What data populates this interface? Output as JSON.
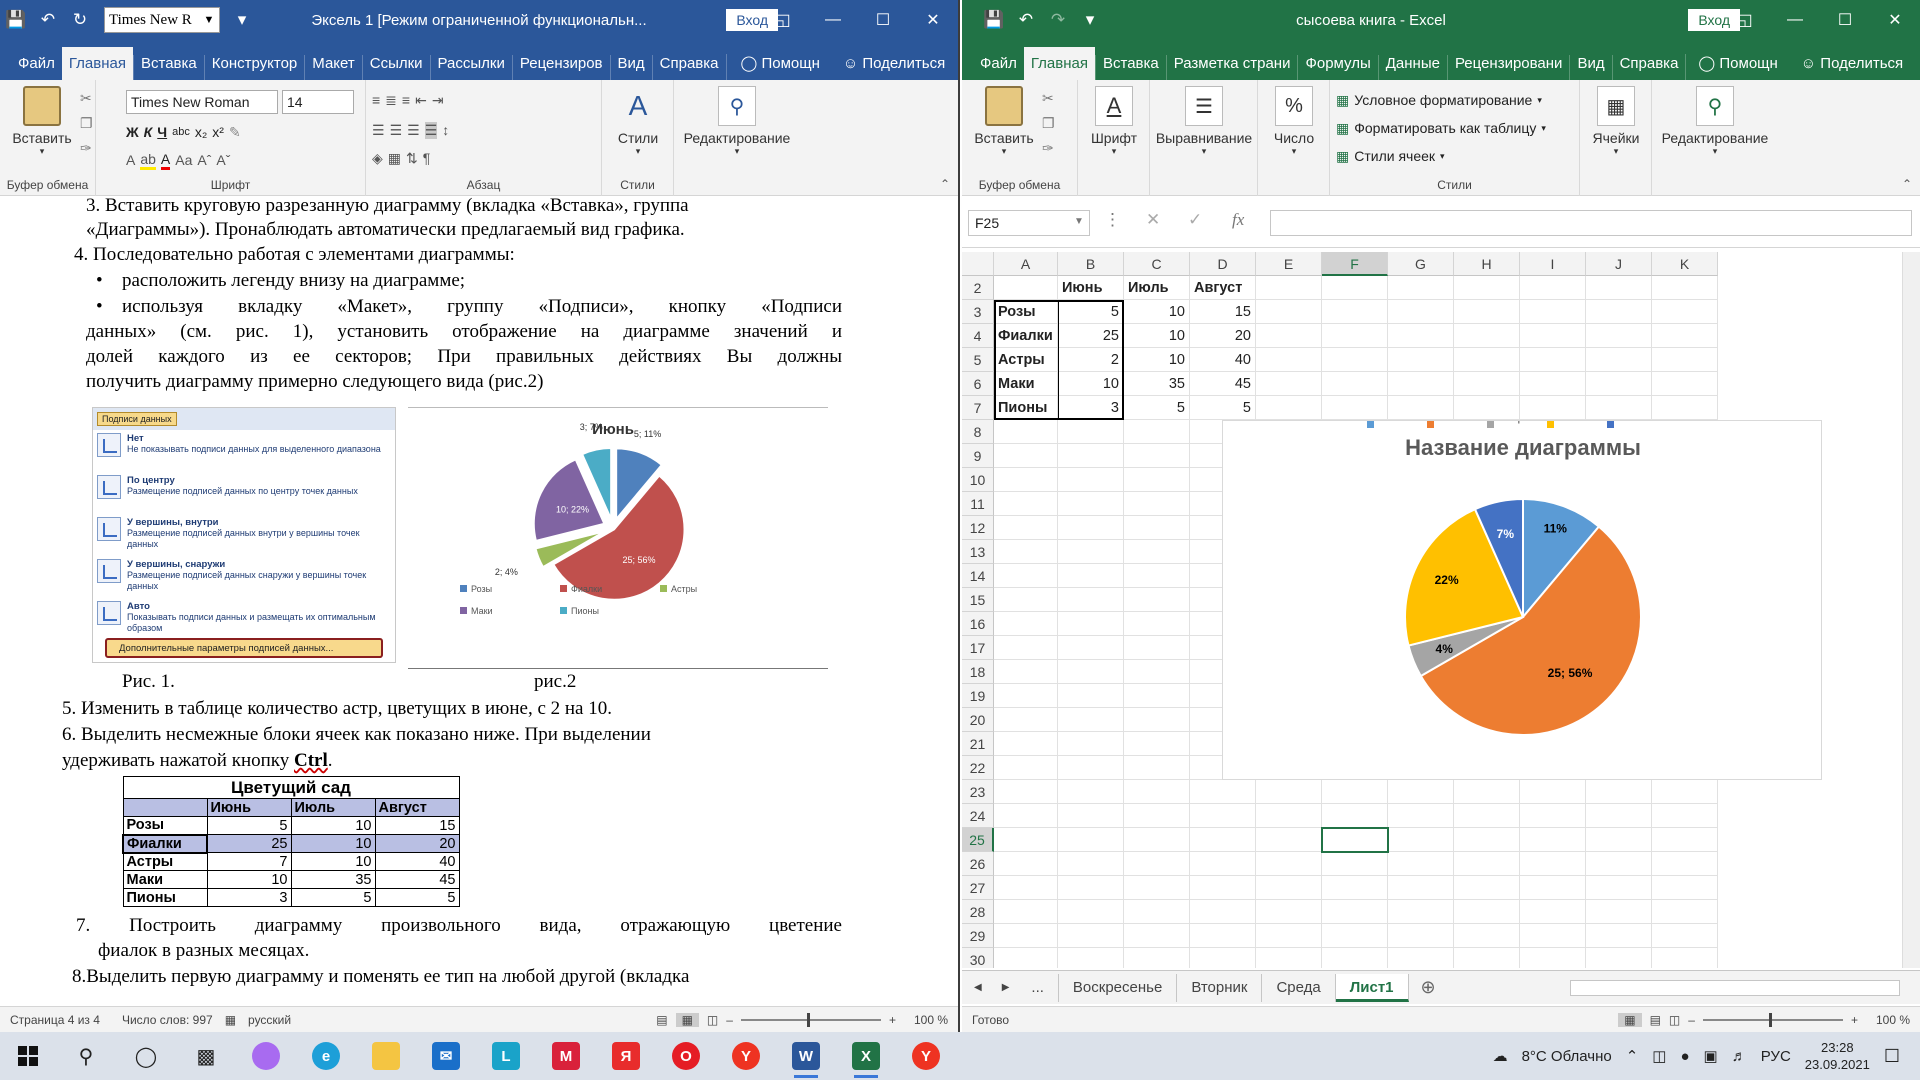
{
  "word": {
    "title": "Эксель 1 [Режим ограниченной функциональн...",
    "font_name_small": "Times New R",
    "login": "Вход",
    "tabs": [
      "Файл",
      "Главная",
      "Вставка",
      "Конструктор",
      "Макет",
      "Ссылки",
      "Рассылки",
      "Рецензиров",
      "Вид",
      "Справка",
      "Помощн",
      "Поделиться"
    ],
    "ribbon": {
      "paste": "Вставить",
      "font_name": "Times New Roman",
      "font_size": "14",
      "styles": "Стили",
      "editing": "Редактирование",
      "groups": [
        "Буфер обмена",
        "Шрифт",
        "Абзац",
        "Стили"
      ]
    },
    "doc": {
      "l1": "3.   Вставить круговую разрезанную диаграмму (вкладка «Вставка», группа",
      "l2": "«Диаграммы»). Пронаблюдать автоматически предлагаемый вид графика.",
      "l3": "4.      Последовательно работая с элементами диаграммы:",
      "l4": "расположить легенду внизу на диаграмме;",
      "l5": "используя вкладку «Макет», группу «Подписи», кнопку «Подписи",
      "l6": "данных» (см. рис. 1), установить отображение на диаграмме значений и",
      "l7": "долей каждого из ее секторов; При правильных действиях Вы должны",
      "l8": "получить диаграмму примерно следующего вида (рис.2)",
      "cap1": "Рис. 1.",
      "cap2": "рис.2",
      "l9": "5.      Изменить в таблице количество астр, цветущих в июне, с 2 на 10.",
      "l10": "6.      Выделить несмежные блоки ячеек как показано ниже. При выделении",
      "l11a": "удерживать нажатой кнопку ",
      "l11b": "Ctrl",
      "l12": "7. Построить    диаграмму    произвольного    вида,    отражающую    цветение",
      "l13": "фиалок в разных месяцах.",
      "l14": "8.Выделить первую диаграмму и поменять ее тип на любой другой (вкладка"
    },
    "fig1": {
      "button": "Подписи данных",
      "items": [
        {
          "title": "Нет",
          "desc": "Не показывать подписи данных для выделенного диапазона"
        },
        {
          "title": "По центру",
          "desc": "Размещение подписей данных по центру точек данных"
        },
        {
          "title": "У вершины, внутри",
          "desc": "Размещение подписей данных внутри у вершины точек данных"
        },
        {
          "title": "У вершины, снаружи",
          "desc": "Размещение подписей данных снаружи у вершины точек данных"
        },
        {
          "title": "Авто",
          "desc": "Показывать подписи данных и размещать их оптимальным образом"
        }
      ],
      "more": "Дополнительные параметры подписей данных..."
    },
    "table": {
      "title": "Цветущий сад",
      "headers": [
        "",
        "Июнь",
        "Июль",
        "Август"
      ],
      "rows": [
        [
          "Розы",
          "5",
          "10",
          "15"
        ],
        [
          "Фиалки",
          "25",
          "10",
          "20"
        ],
        [
          "Астры",
          "7",
          "10",
          "40"
        ],
        [
          "Маки",
          "10",
          "35",
          "45"
        ],
        [
          "Пионы",
          "3",
          "5",
          "5"
        ]
      ]
    },
    "status": {
      "page": "Страница 4 из 4",
      "words": "Число слов: 997",
      "lang": "русский",
      "zoom": "100 %"
    }
  },
  "excel": {
    "title": "сысоева книга  -  Excel",
    "login": "Вход",
    "tabs": [
      "Файл",
      "Главная",
      "Вставка",
      "Разметка страни",
      "Формулы",
      "Данные",
      "Рецензировани",
      "Вид",
      "Справка",
      "Помощн",
      "Поделиться"
    ],
    "ribbon": {
      "paste": "Вставить",
      "font": "Шрифт",
      "align": "Выравнивание",
      "number": "Число",
      "cond": "Условное форматирование",
      "astable": "Форматировать как таблицу",
      "cellstyles": "Стили ячеек",
      "cells": "Ячейки",
      "editing": "Редактирование",
      "groups": [
        "Буфер обмена",
        "Стили"
      ]
    },
    "namebox": "F25",
    "columns": [
      "A",
      "B",
      "C",
      "D",
      "E",
      "F",
      "G",
      "H",
      "I",
      "J",
      "K"
    ],
    "rows": [
      "2",
      "3",
      "4",
      "5",
      "6",
      "7",
      "8",
      "9",
      "10",
      "11",
      "12",
      "13",
      "14",
      "15",
      "16",
      "17",
      "18",
      "19",
      "20",
      "21",
      "22",
      "23",
      "24",
      "25",
      "26",
      "27",
      "28",
      "29",
      "30"
    ],
    "cells": {
      "headers": [
        "Июнь",
        "Июль",
        "Август"
      ],
      "data": [
        [
          "Розы",
          "5",
          "10",
          "15"
        ],
        [
          "Фиалки",
          "25",
          "10",
          "20"
        ],
        [
          "Астры",
          "2",
          "10",
          "40"
        ],
        [
          "Маки",
          "10",
          "35",
          "45"
        ],
        [
          "Пионы",
          "3",
          "5",
          "5"
        ]
      ]
    },
    "sheets": [
      "...",
      "Воскресенье",
      "Вторник",
      "Среда",
      "Лист1"
    ],
    "status": {
      "ready": "Готово",
      "zoom": "100 %"
    }
  },
  "chart_data": [
    {
      "type": "pie",
      "title": "Июнь",
      "categories": [
        "Розы",
        "Фиалки",
        "Астры",
        "Маки",
        "Пионы"
      ],
      "values": [
        5,
        25,
        2,
        10,
        3
      ],
      "labels": [
        "5; 11%",
        "25; 56%",
        "2; 4%",
        "10; 22%",
        "3; 7%"
      ],
      "colors": [
        "#4f81bd",
        "#c0504d",
        "#9bbb59",
        "#8064a2",
        "#4bacc6"
      ],
      "legend": "bottom",
      "exploded": true
    },
    {
      "type": "pie",
      "title": "Название диаграммы",
      "categories": [
        "Розы",
        "Фиалки",
        "Астры",
        "Маки",
        "Пионы"
      ],
      "values": [
        5,
        25,
        2,
        10,
        3
      ],
      "labels": [
        "11%",
        "25; 56%",
        "4%",
        "22%",
        "7%"
      ],
      "colors": [
        "#5b9bd5",
        "#ed7d31",
        "#a5a5a5",
        "#ffc000",
        "#4472c4"
      ],
      "legend": "bottom"
    }
  ],
  "taskbar": {
    "weather": "8°C  Облачно",
    "lang": "РУС",
    "time": "23:28",
    "date": "23.09.2021"
  }
}
